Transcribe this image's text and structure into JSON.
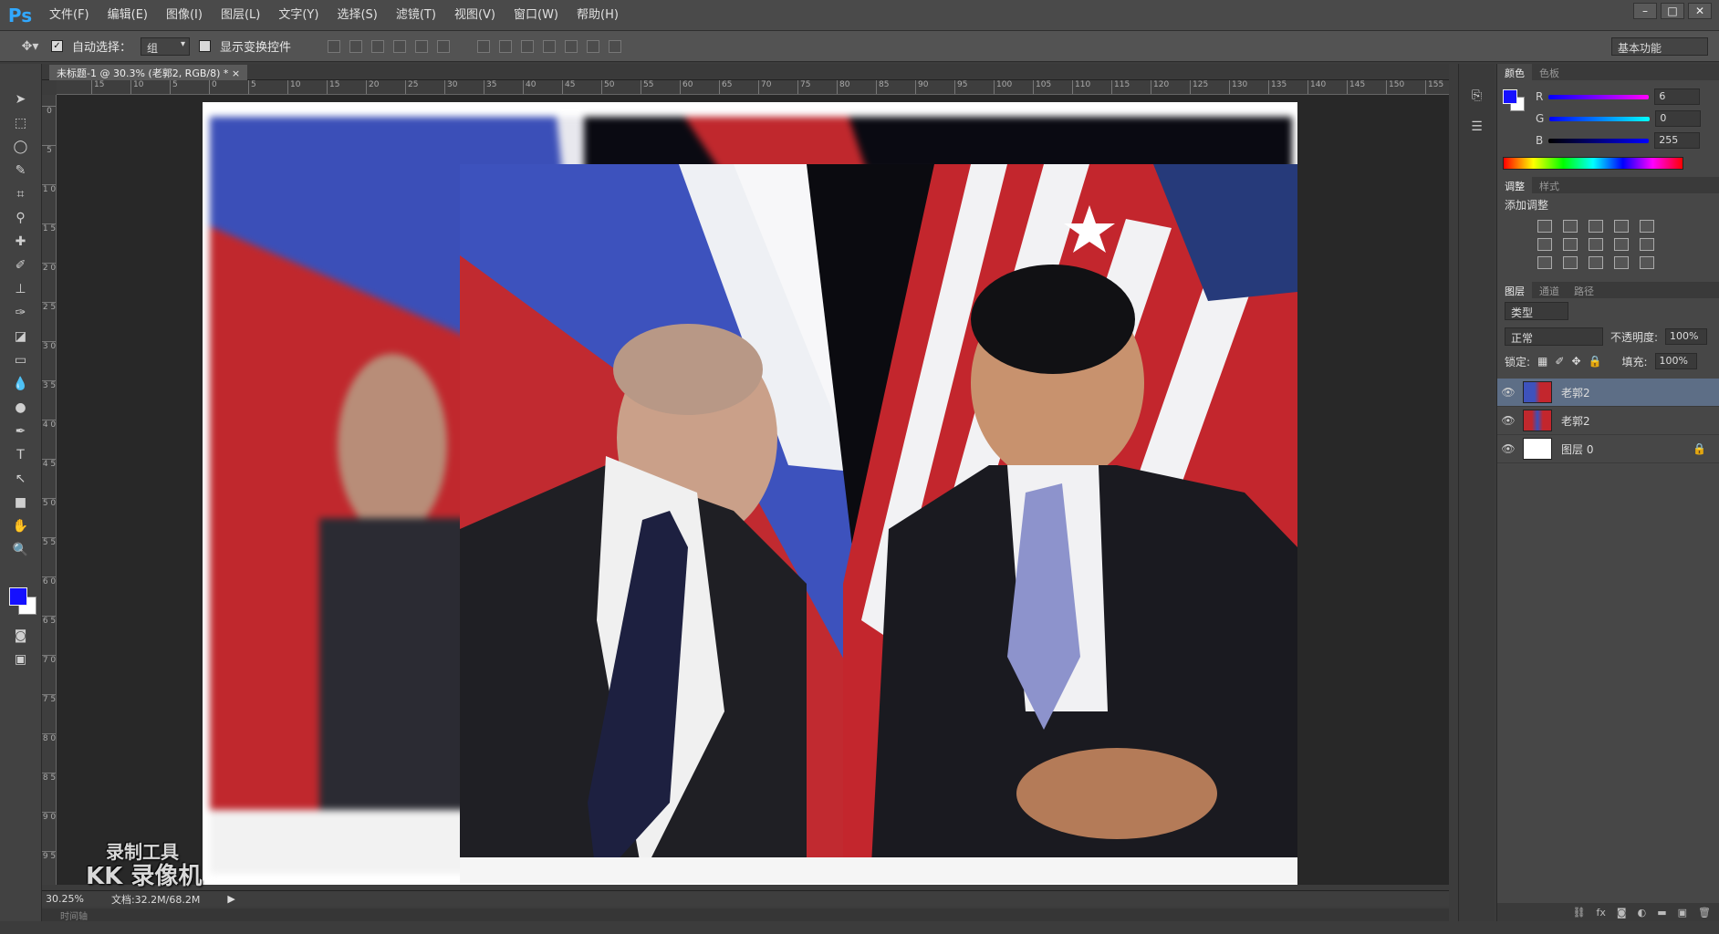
{
  "app": {
    "logo": "Ps"
  },
  "menu": [
    "文件(F)",
    "编辑(E)",
    "图像(I)",
    "图层(L)",
    "文字(Y)",
    "选择(S)",
    "滤镜(T)",
    "视图(V)",
    "窗口(W)",
    "帮助(H)"
  ],
  "window_controls": [
    "–",
    "□",
    "✕"
  ],
  "options": {
    "auto_select_label": "自动选择：",
    "auto_select_value": "组",
    "show_transform_label": "显示变换控件",
    "workspace": "基本功能"
  },
  "document": {
    "tab_title": "未标题-1 @ 30.3% (老郭2, RGB/8) *"
  },
  "ruler": {
    "h_ticks": [
      "15",
      "10",
      "5",
      "0",
      "5",
      "10",
      "15",
      "20",
      "25",
      "30",
      "35",
      "40",
      "45",
      "50",
      "55",
      "60",
      "65",
      "70",
      "75",
      "80",
      "85",
      "90",
      "95",
      "100",
      "105",
      "110",
      "115",
      "120",
      "125",
      "130",
      "135",
      "140",
      "145",
      "150",
      "155"
    ],
    "v_ticks": [
      "0",
      "5",
      "1 0",
      "1 5",
      "2 0",
      "2 5",
      "3 0",
      "3 5",
      "4 0",
      "4 5",
      "5 0",
      "5 5",
      "6 0",
      "6 5",
      "7 0",
      "7 5",
      "8 0",
      "8 5",
      "9 0",
      "9 5"
    ]
  },
  "watermark": {
    "line1": "录制工具",
    "line2": "KK 录像机"
  },
  "status": {
    "zoom": "30.25%",
    "doc_size": "文档:32.2M/68.2M",
    "timeline": "时间轴"
  },
  "color_panel": {
    "tabs": [
      "颜色",
      "色板"
    ],
    "channels": [
      {
        "label": "R",
        "value": "6"
      },
      {
        "label": "G",
        "value": "0"
      },
      {
        "label": "B",
        "value": "255"
      }
    ],
    "foreground": "#1510ff",
    "background": "#ffffff"
  },
  "adjust_panel": {
    "tabs": [
      "调整",
      "样式"
    ],
    "title": "添加调整"
  },
  "layers_panel": {
    "tabs": [
      "图层",
      "通道",
      "路径"
    ],
    "filter_label": "类型",
    "blend_mode": "正常",
    "opacity_label": "不透明度:",
    "opacity": "100%",
    "lock_label": "锁定:",
    "fill_label": "填充:",
    "fill": "100%",
    "layers": [
      {
        "name": "老郭2",
        "selected": true,
        "locked": false
      },
      {
        "name": "老郭2",
        "selected": false,
        "locked": false
      },
      {
        "name": "图层 0",
        "selected": false,
        "locked": true
      }
    ]
  }
}
